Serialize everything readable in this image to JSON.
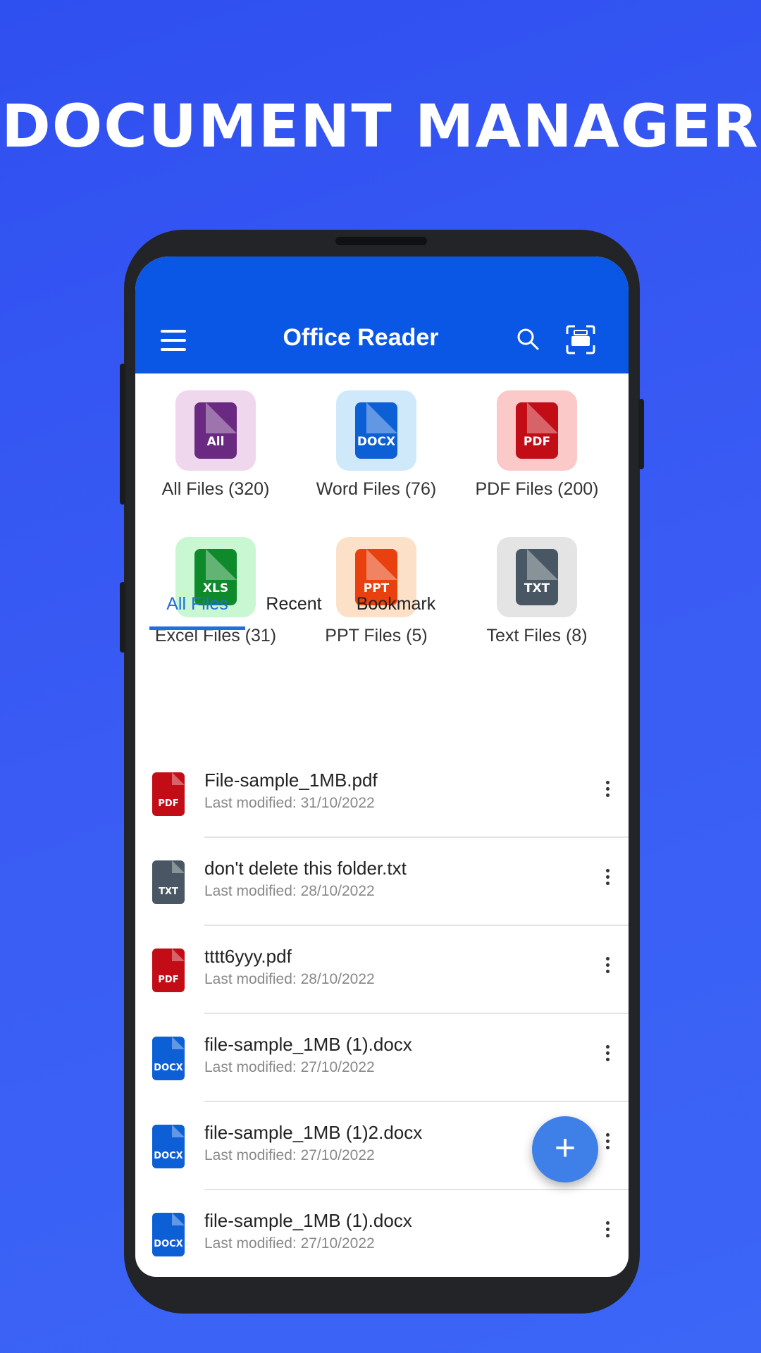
{
  "headline": "DOCUMENT MANAGER",
  "appbar": {
    "title": "Office Reader",
    "menu_icon": "menu-icon",
    "search_icon": "search-icon",
    "scan_icon": "scan-icon"
  },
  "categories": [
    {
      "label": "All Files (320)",
      "tag": "All",
      "color": "#6a2a82",
      "tile": "#efd7ee"
    },
    {
      "label": "Word Files (76)",
      "tag": "DOCX",
      "color": "#0d5fd6",
      "tile": "#cfe9fb"
    },
    {
      "label": "PDF Files (200)",
      "tag": "PDF",
      "color": "#c20d16",
      "tile": "#fcc9c9"
    },
    {
      "label": "Excel Files (31)",
      "tag": "XLS",
      "color": "#0e8a2a",
      "tile": "#c9f7d1"
    },
    {
      "label": "PPT Files (5)",
      "tag": "PPT",
      "color": "#e8400e",
      "tile": "#fde0c8"
    },
    {
      "label": "Text Files (8)",
      "tag": "TXT",
      "color": "#485763",
      "tile": "#e4e4e4"
    }
  ],
  "tabs": [
    {
      "label": "All Files",
      "active": true
    },
    {
      "label": "Recent",
      "active": false
    },
    {
      "label": "Bookmark",
      "active": false
    }
  ],
  "files": [
    {
      "name": "File-sample_1MB.pdf",
      "date": "Last modified: 31/10/2022",
      "tag": "PDF",
      "color": "#c20d16"
    },
    {
      "name": "don't delete this folder.txt",
      "date": "Last modified: 28/10/2022",
      "tag": "TXT",
      "color": "#485763"
    },
    {
      "name": "tttt6yyy.pdf",
      "date": "Last modified: 28/10/2022",
      "tag": "PDF",
      "color": "#c20d16"
    },
    {
      "name": "file-sample_1MB (1).docx",
      "date": "Last modified: 27/10/2022",
      "tag": "DOCX",
      "color": "#0d5fd6"
    },
    {
      "name": "file-sample_1MB (1)2.docx",
      "date": "Last modified: 27/10/2022",
      "tag": "DOCX",
      "color": "#0d5fd6"
    },
    {
      "name": "file-sample_1MB (1).docx",
      "date": "Last modified: 27/10/2022",
      "tag": "DOCX",
      "color": "#0d5fd6"
    }
  ],
  "fab": {
    "label": "+",
    "icon": "plus-icon"
  }
}
